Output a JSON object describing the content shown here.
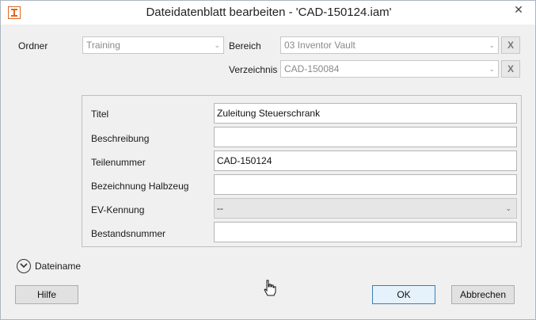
{
  "window": {
    "title": "Dateidatenblatt bearbeiten - 'CAD-150124.iam'",
    "app_icon": "inventor-icon",
    "close_glyph": "✕"
  },
  "location": {
    "ordner_label": "Ordner",
    "ordner_value": "Training",
    "bereich_label": "Bereich",
    "bereich_value": "03 Inventor Vault",
    "verzeichnis_label": "Verzeichnis",
    "verzeichnis_value": "CAD-150084",
    "clear_label": "X"
  },
  "properties": [
    {
      "label": "Titel",
      "value": "Zuleitung Steuerschrank",
      "type": "text"
    },
    {
      "label": "Beschreibung",
      "value": "",
      "type": "text"
    },
    {
      "label": "Teilenummer",
      "value": "CAD-150124",
      "type": "text"
    },
    {
      "label": "Bezeichnung Halbzeug",
      "value": "",
      "type": "text"
    },
    {
      "label": "EV-Kennung",
      "value": "--",
      "type": "dropdown"
    },
    {
      "label": "Bestandsnummer",
      "value": "",
      "type": "text"
    }
  ],
  "expander": {
    "label": "Dateiname",
    "icon": "chevron-down-circle-icon"
  },
  "buttons": {
    "help": "Hilfe",
    "ok": "OK",
    "cancel": "Abbrechen"
  },
  "colors": {
    "accent": "#3c7fb1",
    "icon_orange": "#e0641f"
  }
}
